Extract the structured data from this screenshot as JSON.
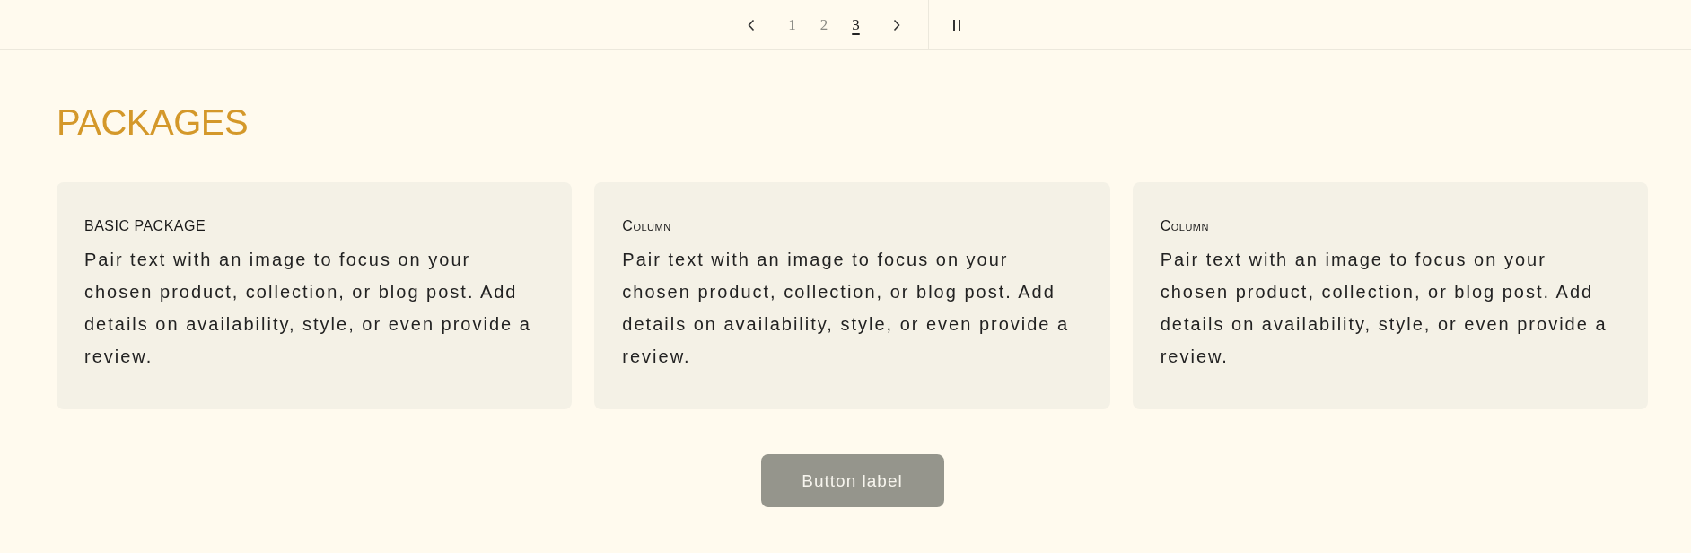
{
  "slideshow_controls": {
    "pages": [
      {
        "label": "1",
        "selected": false
      },
      {
        "label": "2",
        "selected": false
      },
      {
        "label": "3",
        "selected": true
      }
    ]
  },
  "section": {
    "heading": "PACKAGES",
    "cards": [
      {
        "title": "BASIC PACKAGE",
        "text": "Pair text with an image to focus on your chosen product, collection, or blog post. Add details on availability, style, or even provide a review."
      },
      {
        "title": "Column",
        "text": "Pair text with an image to focus on your chosen product, collection, or blog post. Add details on availability, style, or even provide a review."
      },
      {
        "title": "Column",
        "text": "Pair text with an image to focus on your chosen product, collection, or blog post. Add details on availability, style, or even provide a review."
      }
    ],
    "button": "Button label"
  }
}
